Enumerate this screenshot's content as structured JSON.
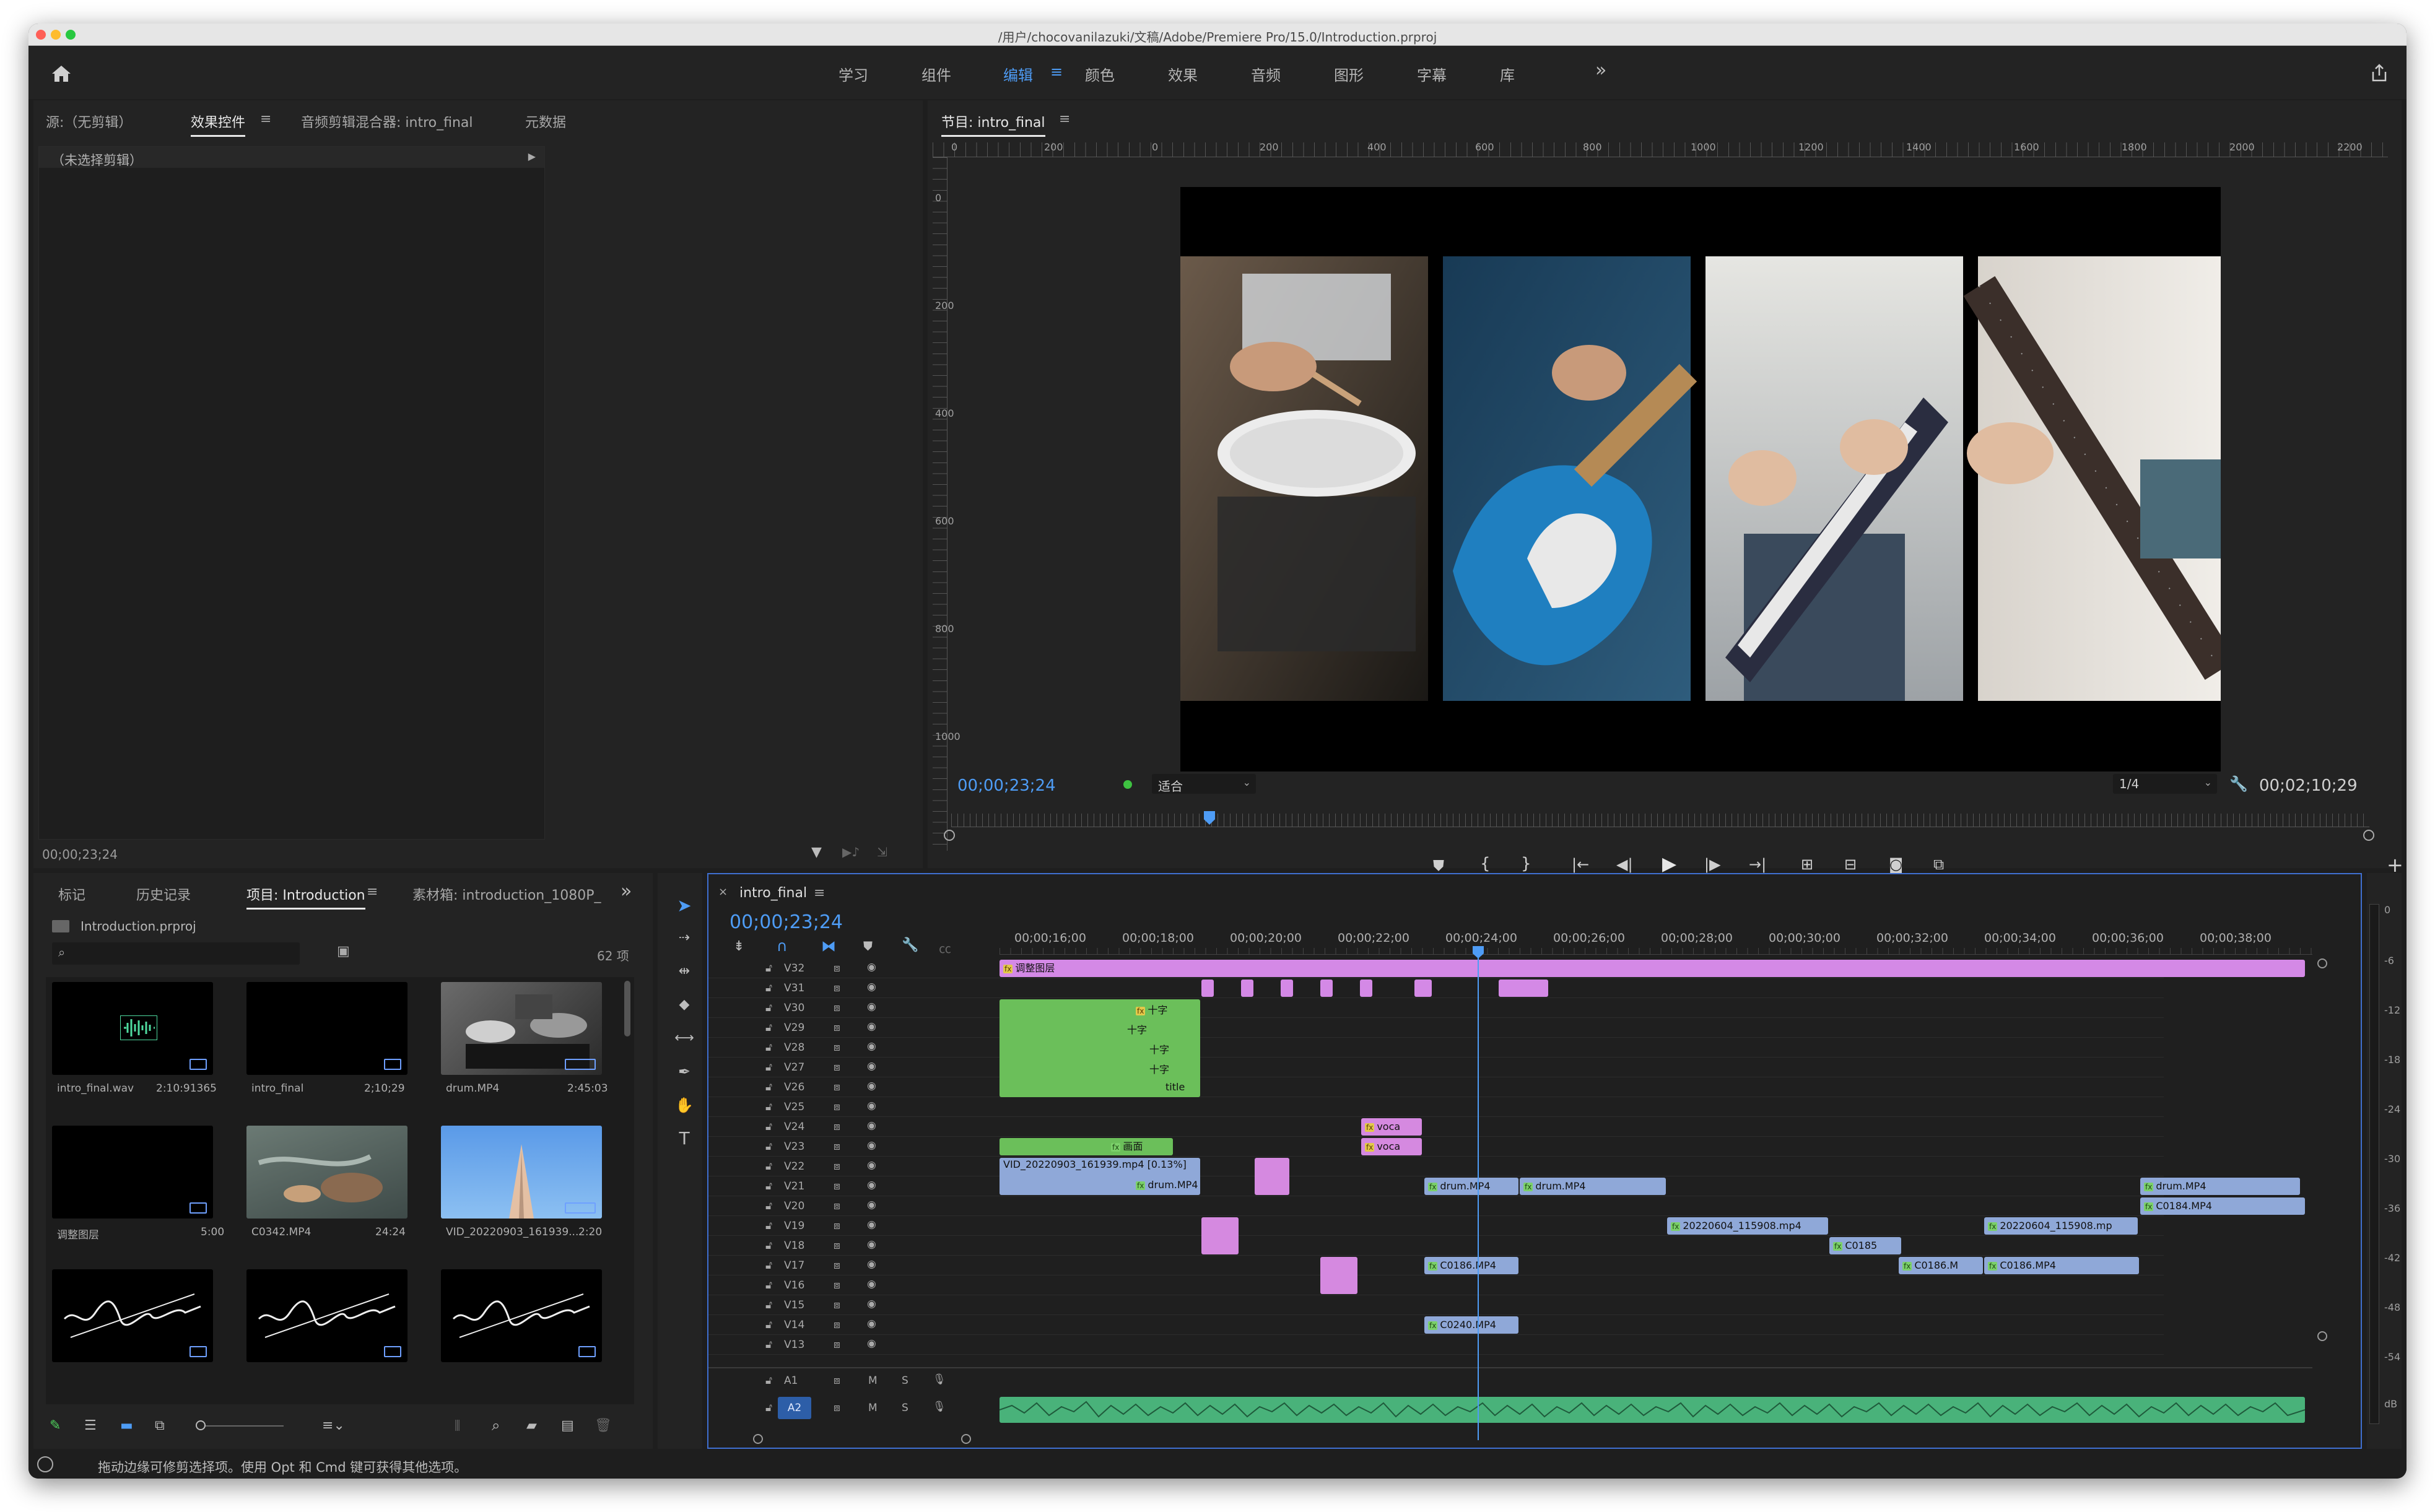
{
  "window": {
    "title": "/用户/chocovanilazuki/文稿/Adobe/Premiere Pro/15.0/Introduction.prproj"
  },
  "workspaces": [
    {
      "label": "学习",
      "active": false
    },
    {
      "label": "组件",
      "active": false
    },
    {
      "label": "编辑",
      "active": true
    },
    {
      "label": "颜色",
      "active": false
    },
    {
      "label": "效果",
      "active": false
    },
    {
      "label": "音频",
      "active": false
    },
    {
      "label": "图形",
      "active": false
    },
    {
      "label": "字幕",
      "active": false
    },
    {
      "label": "库",
      "active": false
    }
  ],
  "source_panel": {
    "tabs": [
      "源:（无剪辑）",
      "效果控件",
      "音频剪辑混合器: intro_final",
      "元数据"
    ],
    "active_tab": "效果控件",
    "no_clip": "（未选择剪辑）",
    "timecode": "00;00;23;24"
  },
  "program_monitor": {
    "title": "节目: intro_final",
    "ruler_labels": [
      "0",
      "200",
      "0",
      "200",
      "400",
      "600",
      "800",
      "1000",
      "1200",
      "1400",
      "1600",
      "1800",
      "2000",
      "2200"
    ],
    "vruler_labels": [
      "0",
      "200",
      "400",
      "600",
      "800",
      "1000"
    ],
    "timecode": "00;00;23;24",
    "fit": "适合",
    "resolution": "1/4",
    "duration": "00;02;10;29"
  },
  "project_panel": {
    "tabs": [
      "标记",
      "历史记录",
      "项目: Introduction",
      "素材箱: introduction_1080P_"
    ],
    "active_tab": "项目: Introduction",
    "project_file": "Introduction.prproj",
    "item_count": "62 项",
    "items": [
      {
        "name": "intro_final.wav",
        "duration": "2:10:91365",
        "kind": "audio"
      },
      {
        "name": "intro_final",
        "duration": "2;10;29",
        "kind": "sequence"
      },
      {
        "name": "drum.MP4",
        "duration": "2:45:03",
        "kind": "drum"
      },
      {
        "name": "调整图层",
        "duration": "5:00",
        "kind": "black"
      },
      {
        "name": "C0342.MP4",
        "duration": "24:24",
        "kind": "water"
      },
      {
        "name": "VID_20220903_161939...",
        "duration": "2:20",
        "kind": "sky"
      },
      {
        "name": "",
        "duration": "",
        "kind": "title"
      },
      {
        "name": "",
        "duration": "",
        "kind": "title"
      },
      {
        "name": "",
        "duration": "",
        "kind": "title"
      }
    ]
  },
  "timeline": {
    "tab": "intro_final",
    "timecode": "00;00;23;24",
    "ruler": [
      "00;00;16;00",
      "00;00;18;00",
      "00;00;20;00",
      "00;00;22;00",
      "00;00;24;00",
      "00;00;26;00",
      "00;00;28;00",
      "00;00;30;00",
      "00;00;32;00",
      "00;00;34;00",
      "00;00;36;00",
      "00;00;38;00"
    ],
    "video_tracks": [
      "V32",
      "V31",
      "V30",
      "V29",
      "V28",
      "V27",
      "V26",
      "V25",
      "V24",
      "V23",
      "V22",
      "V21",
      "V20",
      "V19",
      "V18",
      "V17",
      "V16",
      "V15",
      "V14",
      "V13"
    ],
    "audio_tracks": [
      "A1",
      "A2"
    ],
    "track_ms": {
      "m": "M",
      "s": "S"
    },
    "clip_labels": {
      "adjust": "调整图层",
      "cross1": "十字",
      "cross2": "十字",
      "cross3": "十字",
      "cross4": "十字",
      "title": "title",
      "voca1": "voca",
      "voca2": "voca",
      "picture": "画面",
      "vid": "VID_20220903_161939.mp4 [0.13%]",
      "drum_v21": "drum.MP4",
      "drum_a": "drum.MP4",
      "drum_b": "drum.MP4",
      "drum_r": "drum.MP4",
      "c0184": "C0184.MP4",
      "f115908_a": "20220604_115908.mp4",
      "f115908_b": "20220604_115908.mp",
      "c0185": "C0185",
      "c0186_a": "C0186.MP4",
      "c0186_b": "C0186.M",
      "c0186_c": "C0186.MP4",
      "c0240": "C0240.MP4"
    }
  },
  "audio_meter": {
    "labels": [
      "0",
      "-6",
      "-12",
      "-18",
      "-24",
      "-30",
      "-36",
      "-42",
      "-48",
      "-54",
      "dB"
    ]
  },
  "status_bar": {
    "text": "拖动边缘可修剪选择项。使用 Opt 和 Cmd 键可获得其他选项。"
  },
  "colors": {
    "accent": "#4e9cf5",
    "adjust_layer": "#d489e6",
    "graphics": "#6bbf5a",
    "video": "#8fa8d8",
    "audio": "#5cc48c"
  }
}
